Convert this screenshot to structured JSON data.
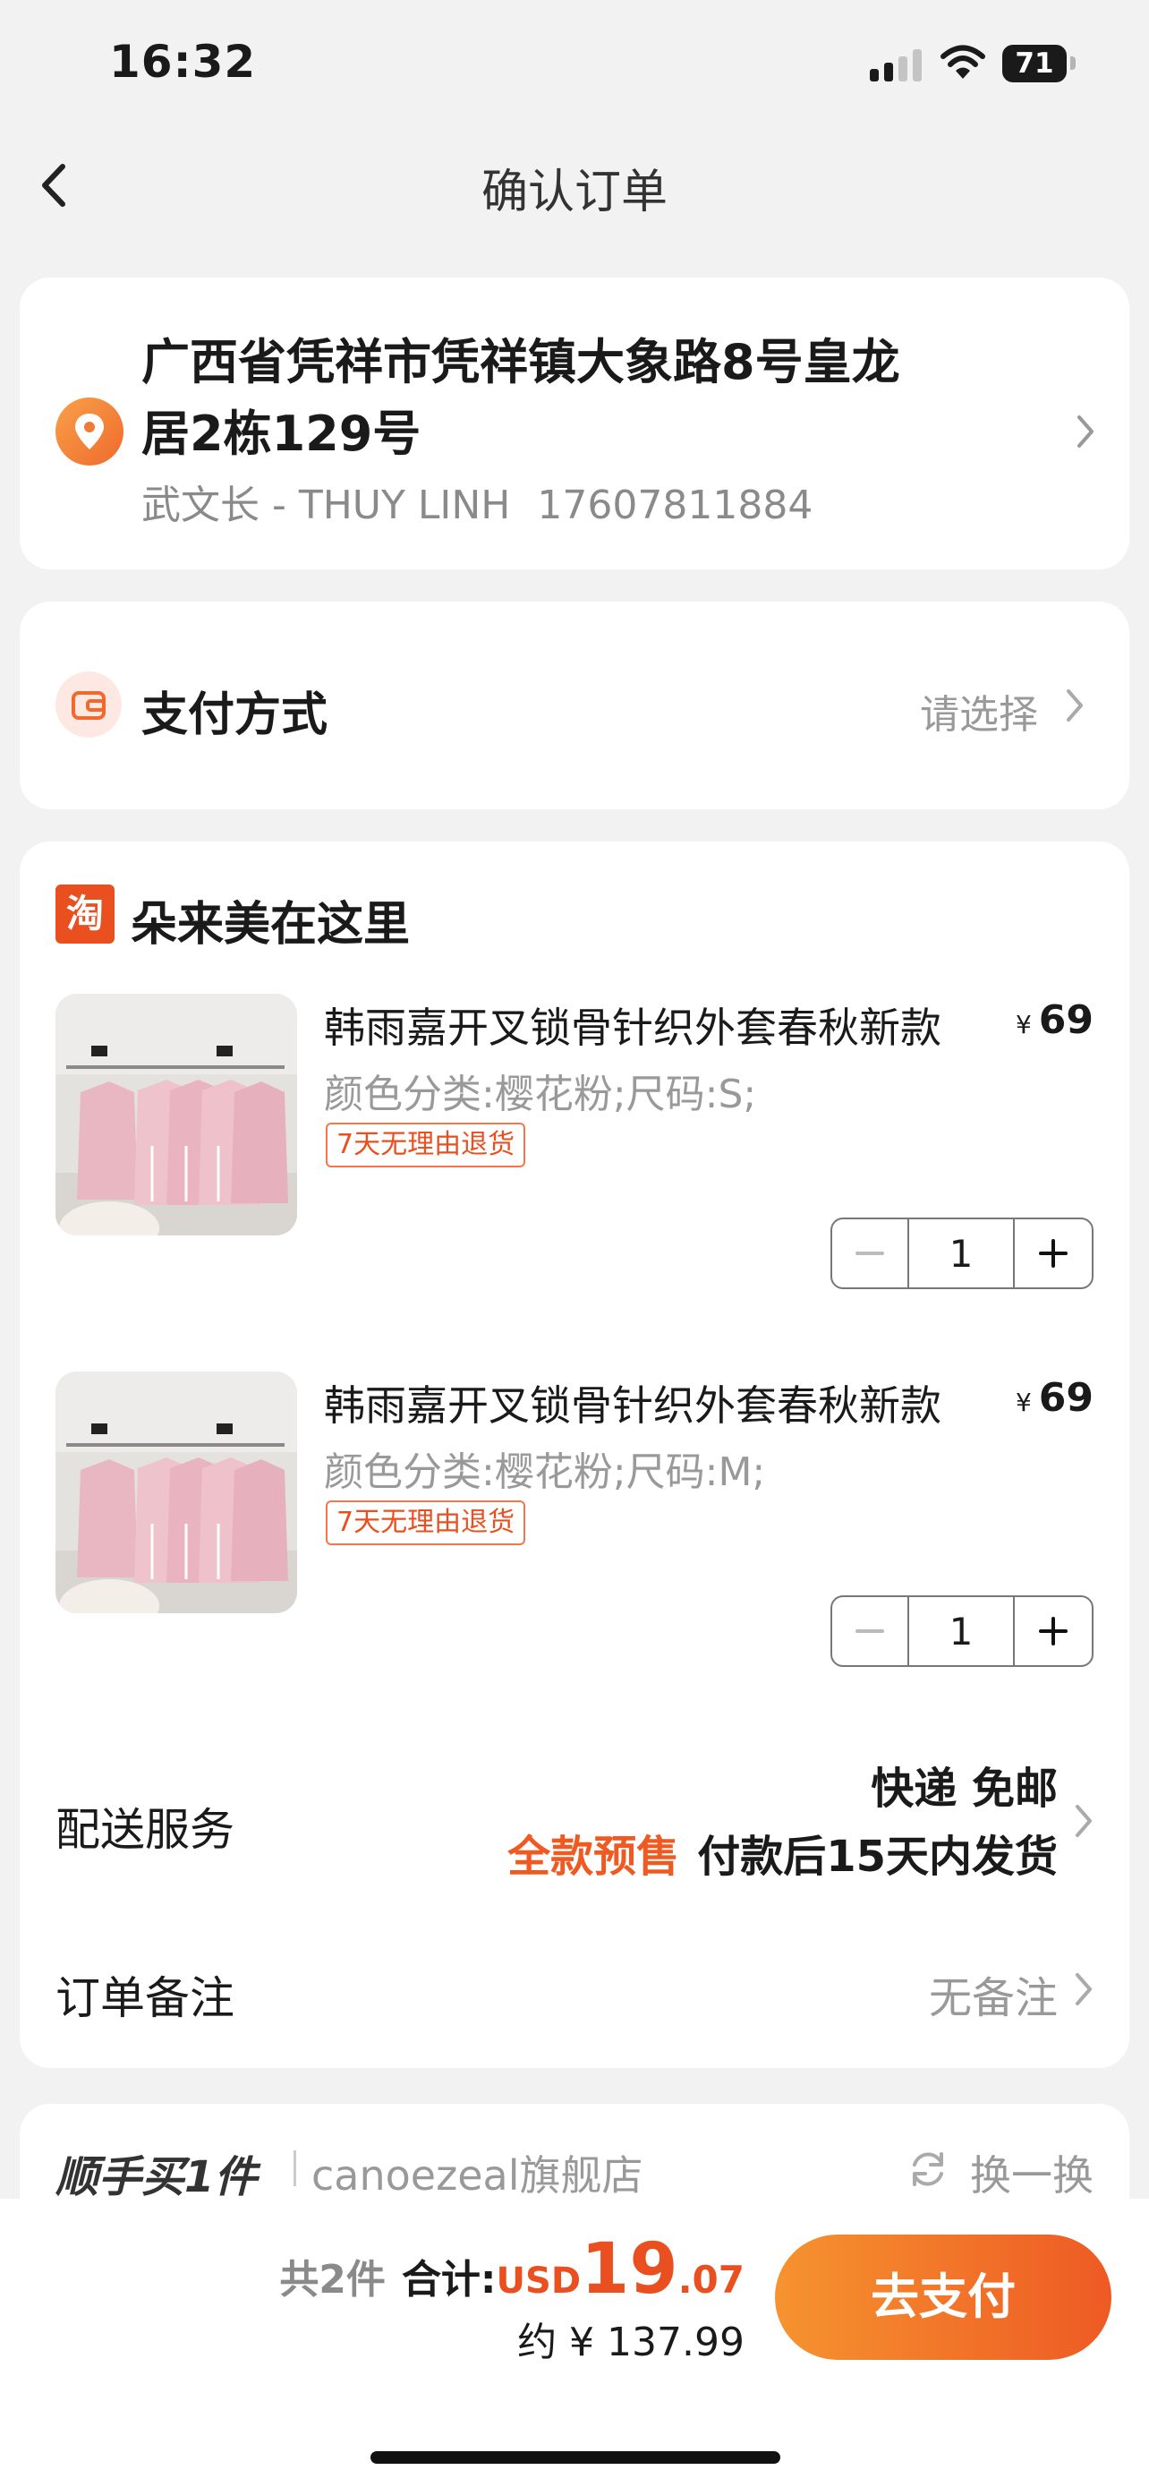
{
  "status_bar": {
    "time": "16:32",
    "battery": "71"
  },
  "nav": {
    "title": "确认订单"
  },
  "address": {
    "line1": "广西省凭祥市凭祥镇大象路8号皇龙",
    "line2": "居2栋129号",
    "recipient": "武文长 - THUY LINH",
    "phone": "17607811884"
  },
  "payment": {
    "label": "支付方式",
    "value": "请选择"
  },
  "shop": {
    "badge": "淘",
    "name": "朵来美在这里"
  },
  "products": [
    {
      "title": "韩雨嘉开叉锁骨针织外套春秋新款",
      "sku": "颜色分类:樱花粉;尺码:S;",
      "tag": "7天无理由退货",
      "currency": "¥",
      "price": "69",
      "qty": "1"
    },
    {
      "title": "韩雨嘉开叉锁骨针织外套春秋新款",
      "sku": "颜色分类:樱花粉;尺码:M;",
      "tag": "7天无理由退货",
      "currency": "¥",
      "price": "69",
      "qty": "1"
    }
  ],
  "shipping": {
    "label": "配送服务",
    "line1": "快递 免邮",
    "presale": "全款预售",
    "line2": "付款后15天内发货"
  },
  "note": {
    "label": "订单备注",
    "value": "无备注"
  },
  "extra": {
    "title": "顺手买1件",
    "store": "canoezeal旗舰店",
    "swap": "换一换"
  },
  "total": {
    "count": "共2件",
    "label": "合计:",
    "currency": "USD",
    "integer": "19",
    "decimal": ".07",
    "approx": "约 ¥ 137.99"
  },
  "checkout": {
    "button": "去支付"
  },
  "colors": {
    "accent": "#ea4f1f",
    "button_start": "#f6932f",
    "button_end": "#ee5a24"
  }
}
